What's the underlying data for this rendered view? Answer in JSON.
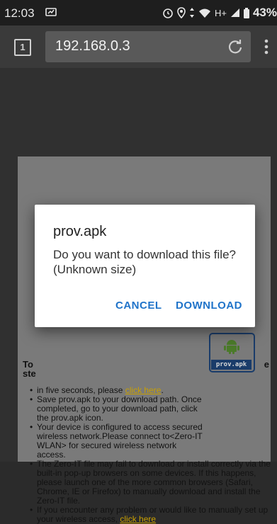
{
  "status_bar": {
    "time": "12:03",
    "network": "H+",
    "battery": "43%"
  },
  "browser": {
    "tab_count": "1",
    "url": "192.168.0.3"
  },
  "page": {
    "heading_left": "To\nste",
    "heading_right": "e",
    "steps": [
      {
        "text": "in five seconds, please ",
        "link": "click here",
        "after": "."
      },
      {
        "text": "Save prov.apk to your download path. Once completed, go to your download path, click the prov.apk icon.",
        "link": "",
        "after": ""
      },
      {
        "text": "Your device is configured to access secured wireless network.Please connect to<Zero-IT WLAN> for secured wireless network access.",
        "link": "",
        "after": ""
      },
      {
        "text": "The Zero-IT file may fail to download or install correctly via the built-in pop-up browsers on some devices. If this happens, please launch one of the more common browsers (Safari, Chrome, IE or Firefox) to manually download and install the Zero-IT file.",
        "link": "",
        "after": ""
      },
      {
        "text": "If you encounter any problem or would like to manually set up your wireless access, ",
        "link": "click here",
        "after": ""
      }
    ],
    "apk_label": "prov.apk"
  },
  "dialog": {
    "title": "prov.apk",
    "message": "Do you want to download this file? (Unknown size)",
    "cancel_label": "CANCEL",
    "download_label": "DOWNLOAD"
  },
  "colors": {
    "accent": "#1f73c9",
    "link": "#c9a000"
  }
}
